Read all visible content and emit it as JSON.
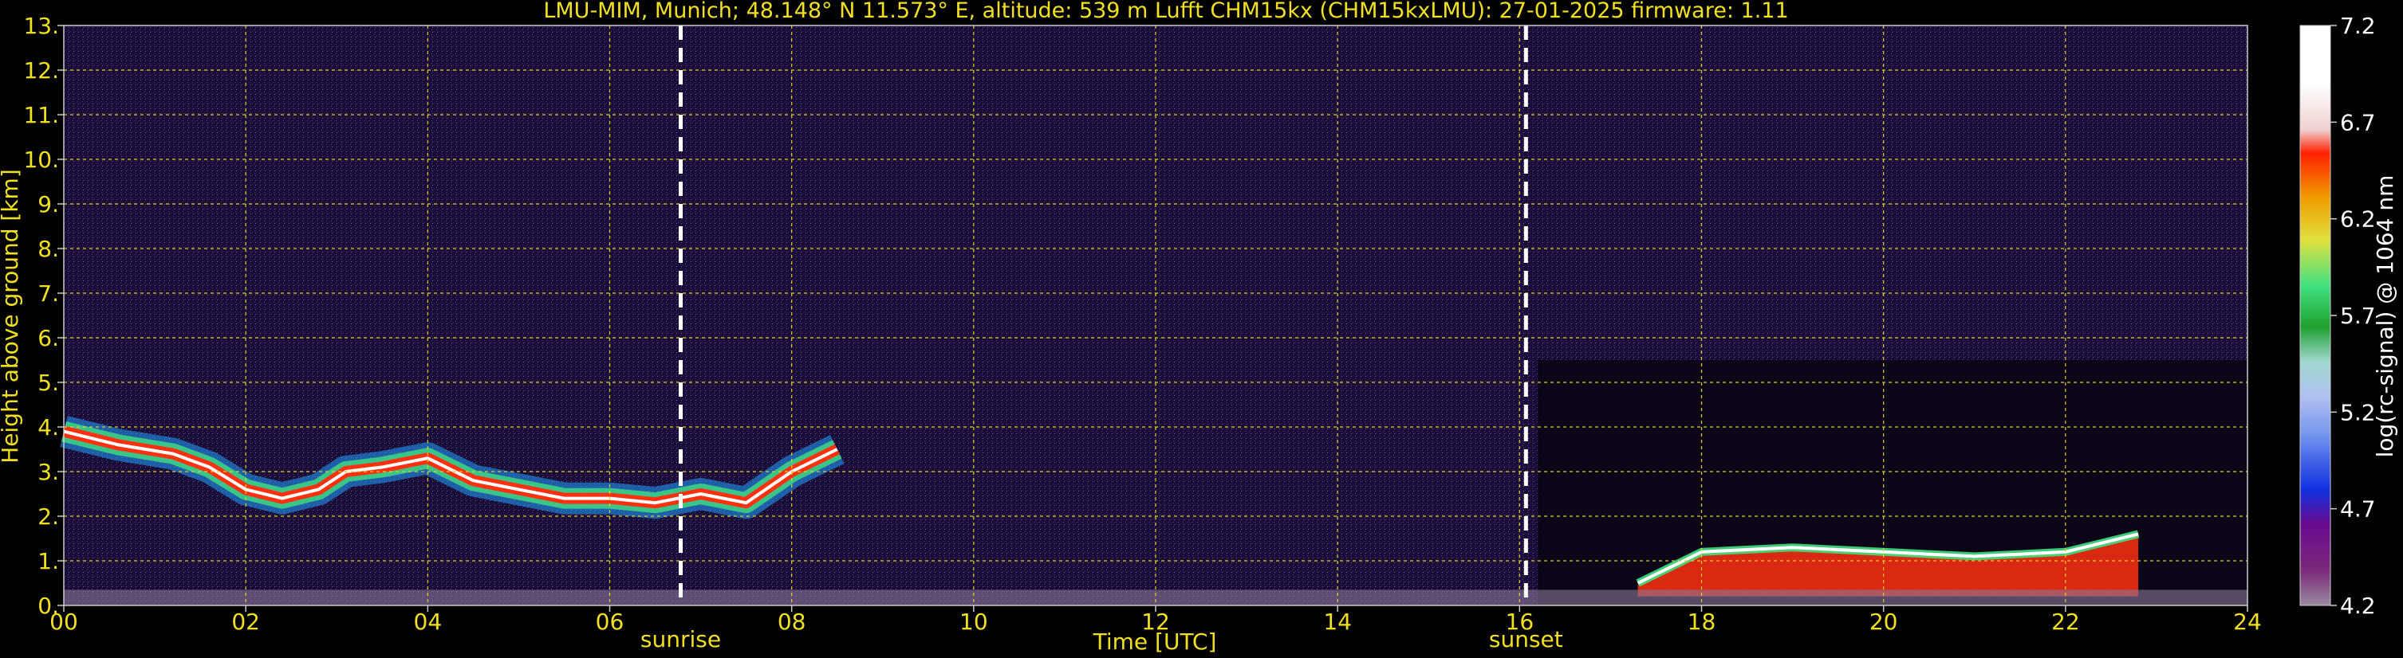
{
  "chart_data": {
    "type": "heatmap",
    "title": "LMU-MIM, Munich; 48.148° N 11.573° E, altitude: 539 m    Lufft CHM15kx (CHM15kxLMU): 27-01-2025    firmware: 1.11",
    "xlabel": "Time [UTC]",
    "ylabel": "Height above ground [km]",
    "xlim": [
      0,
      24
    ],
    "ylim": [
      0,
      13
    ],
    "x_ticks": [
      "00",
      "02",
      "04",
      "06",
      "08",
      "10",
      "12",
      "14",
      "16",
      "18",
      "20",
      "22",
      "24"
    ],
    "y_ticks": [
      "0.",
      "1.",
      "2.",
      "3.",
      "4.",
      "5.",
      "6.",
      "7.",
      "8.",
      "9.",
      "10.",
      "11.",
      "12.",
      "13."
    ],
    "grid": true,
    "events": [
      {
        "label": "sunrise",
        "time_h": 6.78
      },
      {
        "label": "sunset",
        "time_h": 16.07
      }
    ],
    "colorbar": {
      "label": "log(rc-signal) @ 1064 nm",
      "range": [
        4.2,
        7.2
      ],
      "ticks": [
        "4.2",
        "4.7",
        "5.2",
        "5.7",
        "6.2",
        "6.7",
        "7.2"
      ]
    },
    "layers": [
      {
        "kind": "boundary_layer_top",
        "points": [
          [
            0.0,
            3.9
          ],
          [
            0.6,
            3.6
          ],
          [
            1.2,
            3.4
          ],
          [
            1.6,
            3.1
          ],
          [
            2.0,
            2.6
          ],
          [
            2.4,
            2.4
          ],
          [
            2.8,
            2.6
          ],
          [
            3.1,
            3.0
          ],
          [
            3.5,
            3.1
          ],
          [
            4.0,
            3.3
          ],
          [
            4.5,
            2.8
          ],
          [
            5.0,
            2.6
          ],
          [
            5.5,
            2.4
          ],
          [
            6.0,
            2.4
          ],
          [
            6.5,
            2.3
          ],
          [
            7.0,
            2.5
          ],
          [
            7.5,
            2.3
          ],
          [
            8.0,
            3.0
          ],
          [
            8.5,
            3.5
          ]
        ]
      },
      {
        "kind": "cloud_band",
        "points": [
          [
            17.3,
            0.5
          ],
          [
            18.0,
            1.2
          ],
          [
            19.0,
            1.3
          ],
          [
            20.0,
            1.2
          ],
          [
            21.0,
            1.1
          ],
          [
            22.0,
            1.2
          ],
          [
            22.8,
            1.6
          ]
        ]
      }
    ]
  }
}
